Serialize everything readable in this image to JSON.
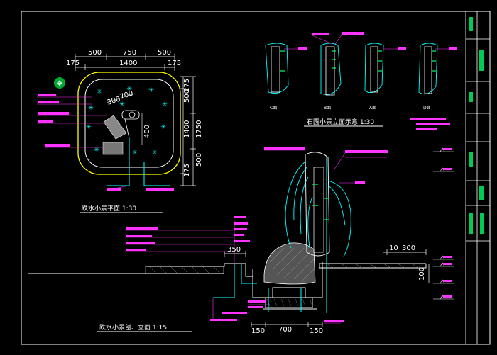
{
  "plan": {
    "dims_top": [
      "500",
      "750",
      "500"
    ],
    "dims_top2": [
      "175",
      "1400",
      "175"
    ],
    "dims_right": [
      "175",
      "500",
      "1400",
      "1750",
      "500",
      "175"
    ],
    "inner_dims": [
      "300",
      "700",
      "400"
    ],
    "title": "跌水小景平面 1:30"
  },
  "elevations": {
    "labels": [
      "C面",
      "B面",
      "A面",
      "D面"
    ],
    "title": "石圆小景立面示意 1:30"
  },
  "section": {
    "dims": [
      "350",
      "10",
      "300",
      "100",
      "150",
      "700",
      "150"
    ],
    "title": "跌水小景剖、立面 1:15"
  }
}
